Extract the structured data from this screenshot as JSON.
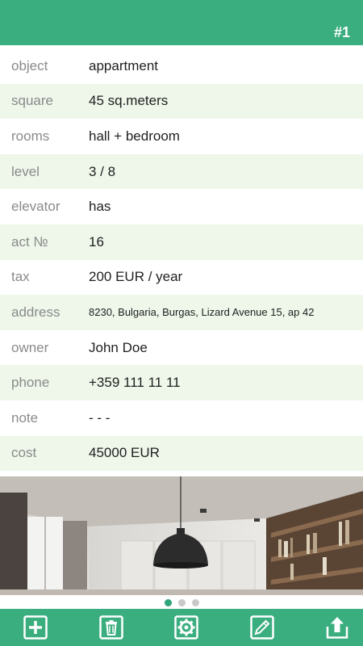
{
  "header": {
    "record_id": "#1"
  },
  "fields": [
    {
      "label": "object",
      "value": "appartment"
    },
    {
      "label": "square",
      "value": "45 sq.meters"
    },
    {
      "label": "rooms",
      "value": "hall + bedroom"
    },
    {
      "label": "level",
      "value": "3 / 8"
    },
    {
      "label": "elevator",
      "value": "has"
    },
    {
      "label": "act №",
      "value": "16"
    },
    {
      "label": "tax",
      "value": "200 EUR / year"
    },
    {
      "label": "address",
      "value": "8230, Bulgaria, Burgas, Lizard Avenue 15, ap 42"
    },
    {
      "label": "owner",
      "value": "John Doe"
    },
    {
      "label": "phone",
      "value": "+359 111 11 11"
    },
    {
      "label": "note",
      "value": "- - -"
    },
    {
      "label": "cost",
      "value": "45000 EUR"
    }
  ],
  "gallery": {
    "total": 3,
    "active_index": 0
  },
  "toolbar": {
    "icons": [
      "add-icon",
      "trash-icon",
      "gear-icon",
      "pencil-icon",
      "share-icon"
    ]
  },
  "colors": {
    "brand": "#3aae7f",
    "stripe": "#eef7ea",
    "label_text": "#8a8a8a",
    "active_dot": "#2fa57a"
  }
}
